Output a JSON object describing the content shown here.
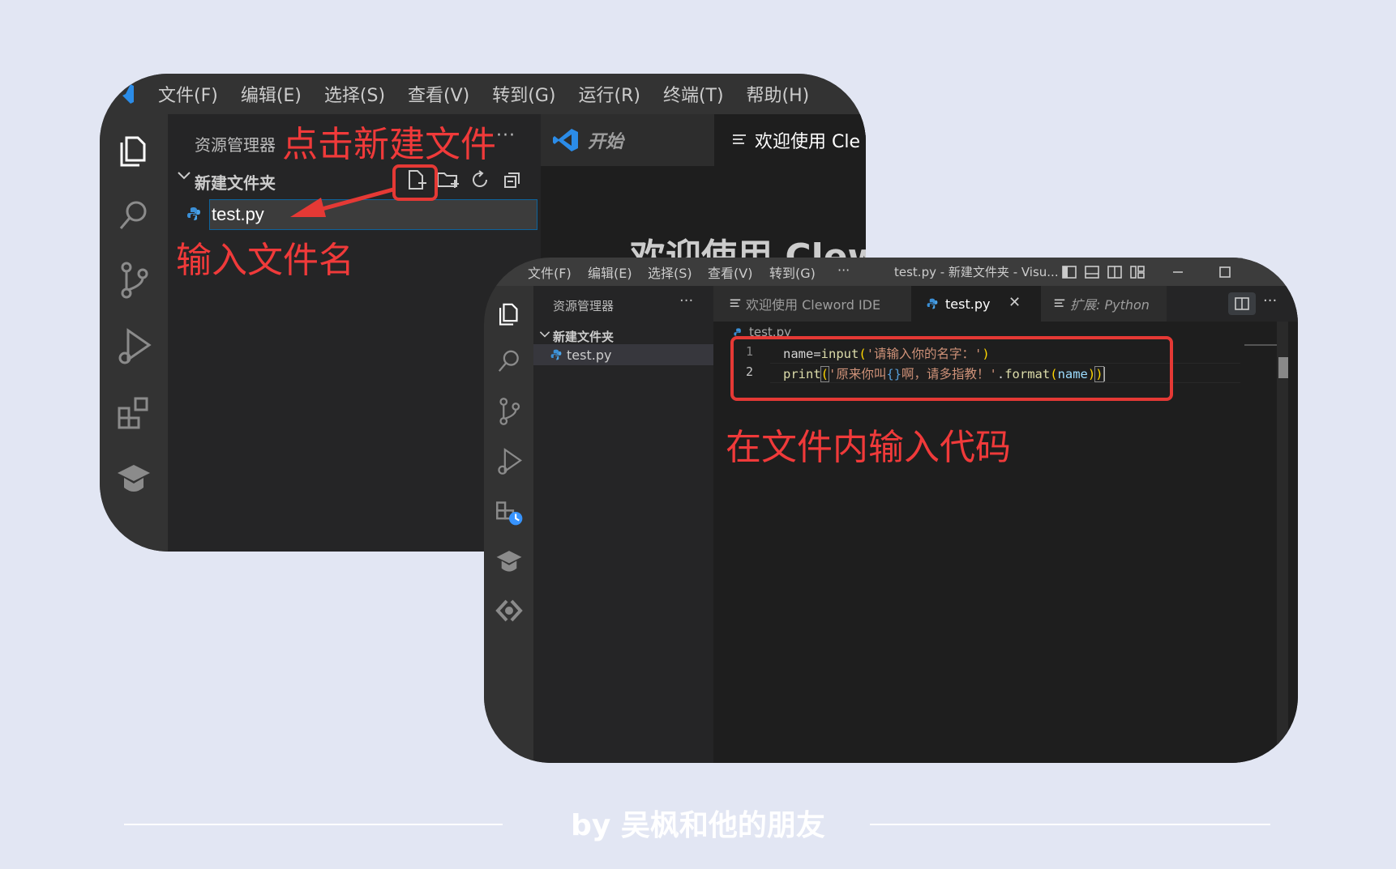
{
  "back_window": {
    "menu": [
      "文件(F)",
      "编辑(E)",
      "选择(S)",
      "查看(V)",
      "转到(G)",
      "运行(R)",
      "终端(T)",
      "帮助(H)"
    ],
    "explorer_title": "资源管理器",
    "explorer_more": "···",
    "folder_name": "新建文件夹",
    "rename_value": "test.py",
    "tabs": [
      {
        "label": "开始",
        "icon": "vscode-logo-icon"
      },
      {
        "label": "欢迎使用 Cle",
        "icon": "menu-lines-icon"
      }
    ],
    "welcome_heading": "欢迎使用 Clew"
  },
  "front_window": {
    "menu": [
      "文件(F)",
      "编辑(E)",
      "选择(S)",
      "查看(V)",
      "转到(G)",
      "···"
    ],
    "window_title": "test.py - 新建文件夹 - Visu...",
    "explorer_title": "资源管理器",
    "explorer_more": "···",
    "folder_name": "新建文件夹",
    "file_name": "test.py",
    "tabs": [
      {
        "label": "欢迎使用 Cleword IDE"
      },
      {
        "label": "test.py",
        "close": "✕"
      },
      {
        "label": "扩展: Python"
      }
    ],
    "tab_more": "···",
    "breadcrumb": "test.py",
    "code_lines": [
      {
        "number": "1",
        "text": "name=input('请输入你的名字：')"
      },
      {
        "number": "2",
        "text": "print('原来你叫{}啊，请多指教！'.format(name))"
      }
    ]
  },
  "annotations": {
    "click_new_file": "点击新建文件",
    "enter_file_name": "输入文件名",
    "enter_code": "在文件内输入代码"
  },
  "byline": "by 吴枫和他的朋友",
  "colors": {
    "annotation": "#f03a3a",
    "background": "#e2e6f3",
    "editor_bg": "#1e1e1e",
    "sidebar_bg": "#252526",
    "activity_bg": "#333333"
  }
}
